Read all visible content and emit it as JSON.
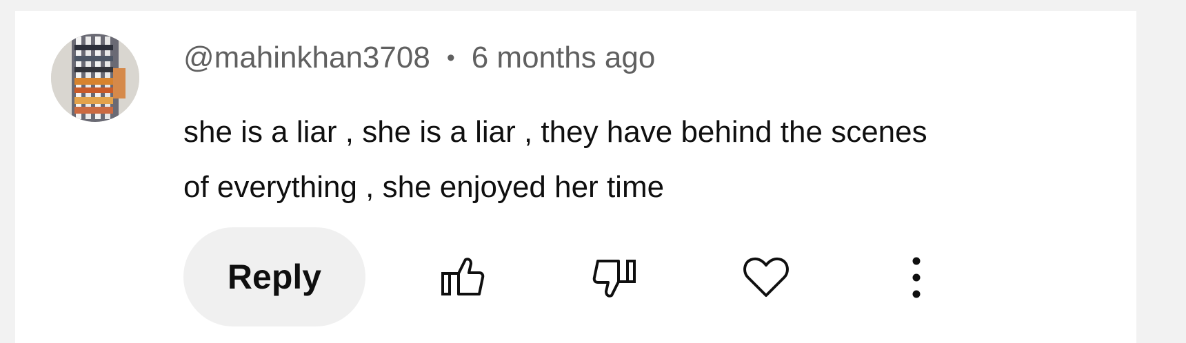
{
  "comment": {
    "author": "@mahinkhan3708",
    "separator": "•",
    "timestamp": "6 months ago",
    "text_lines": [
      "she is a liar , she is a liar , they have behind the scenes",
      "of everything , she enjoyed her time"
    ]
  },
  "actions": {
    "reply_label": "Reply"
  },
  "icons": {
    "avatar": "avatar-image",
    "like": "thumb-up-icon",
    "dislike": "thumb-down-icon",
    "heart": "heart-icon",
    "more": "more-vert-icon"
  },
  "colors": {
    "background": "#f2f2f2",
    "card": "#ffffff",
    "text": "#0f0f0f",
    "meta_text": "#606060",
    "reply_button": "#f0f0f0"
  }
}
